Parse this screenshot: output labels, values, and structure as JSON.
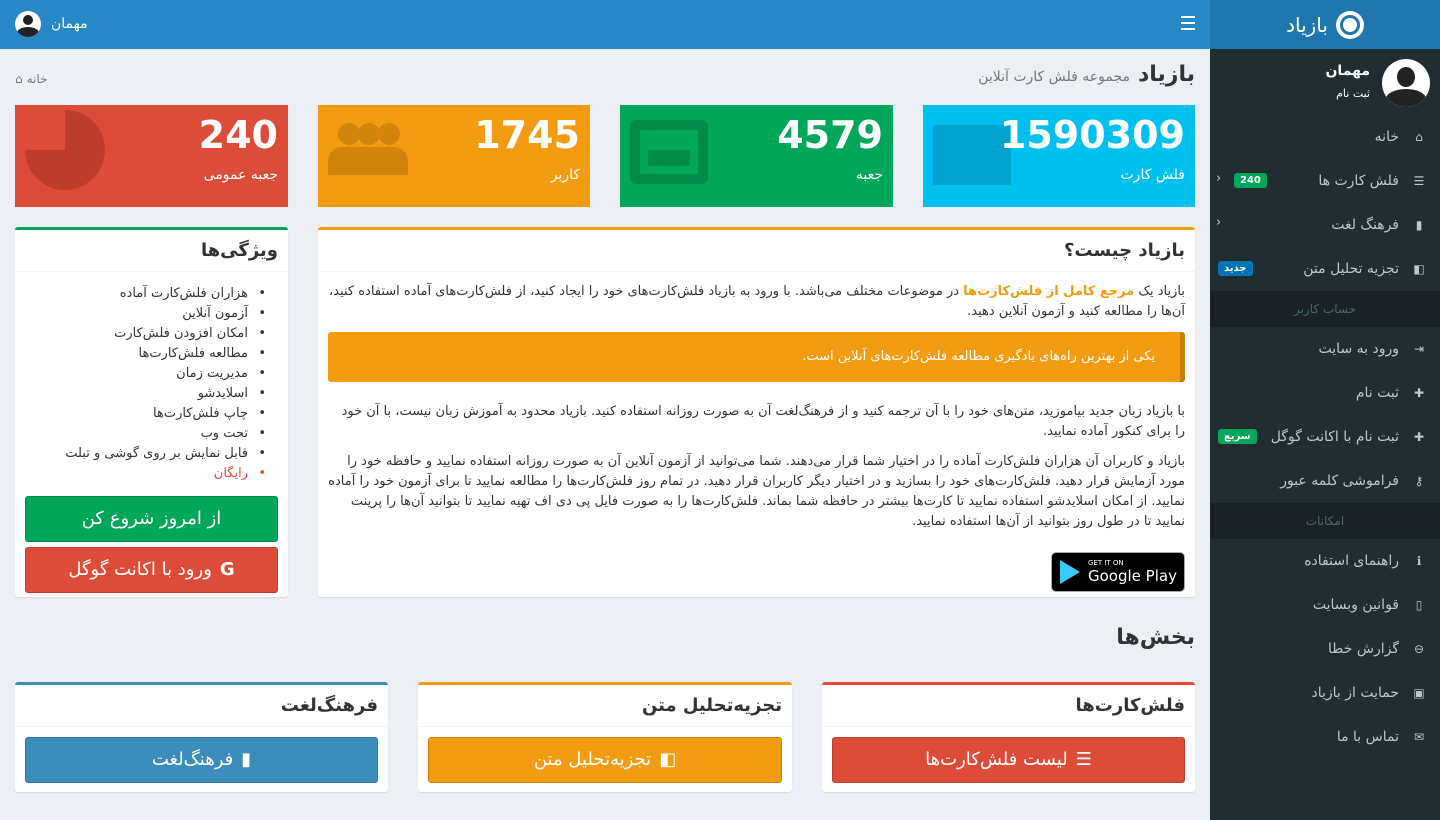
{
  "app": {
    "brand": "بازیاد",
    "user_name": "مهمان"
  },
  "sidebar": {
    "user_name": "مهمان",
    "user_sub": "ثبت نام",
    "items": [
      {
        "label": "خانه",
        "icon": "home-icon"
      },
      {
        "label": "فلش کارت ها",
        "icon": "database-icon",
        "badge": "240",
        "badge_color": "#00a65a"
      },
      {
        "label": "فرهنگ لغت",
        "icon": "book-icon"
      },
      {
        "label": "تجزیه تحلیل متن",
        "icon": "translate-icon",
        "badge": "جدید",
        "badge_color": "#0073b7"
      }
    ],
    "header_account": "حساب کاربر",
    "account_items": [
      {
        "label": "ورود به سایت",
        "icon": "sign-in-icon"
      },
      {
        "label": "ثبت نام",
        "icon": "user-plus-icon"
      },
      {
        "label": "ثبت نام با اکانت گوگل",
        "icon": "user-plus-icon",
        "badge": "سریع",
        "badge_color": "#00a65a"
      },
      {
        "label": "فراموشی کلمه عبور",
        "icon": "key-icon"
      }
    ],
    "header_features": "امکانات",
    "feature_items": [
      {
        "label": "راهنمای استفاده",
        "icon": "info-icon"
      },
      {
        "label": "قوانین وبسایت",
        "icon": "file-icon"
      },
      {
        "label": "گزارش خطا",
        "icon": "minus-circle-icon"
      },
      {
        "label": "حمایت از بازیاد",
        "icon": "money-icon"
      },
      {
        "label": "تماس با ما",
        "icon": "envelope-icon"
      }
    ]
  },
  "header": {
    "title": "بازیاد",
    "subtitle": "مجموعه فلش کارت آنلاین",
    "breadcrumb": "خانه"
  },
  "stats": [
    {
      "value": "1590309",
      "label": "فلش کارت",
      "color": "#00c0ef",
      "icon": "folder-icon"
    },
    {
      "value": "4579",
      "label": "جعبه",
      "color": "#00a65a",
      "icon": "inbox-icon"
    },
    {
      "value": "1745",
      "label": "کاربر",
      "color": "#f39c12",
      "icon": "users-icon"
    },
    {
      "value": "240",
      "label": "جعبه عمومی",
      "color": "#dd4b39",
      "icon": "pie-chart-icon"
    }
  ],
  "about": {
    "title": "بازیاد چیست؟",
    "p1_before": "بازیاد یک ",
    "p1_highlight": "مرجع کامل از فلش‌کارت‌ها",
    "p1_after": " در موضوعات مختلف می‌باشد. با ورود به بازیاد فلش‌کارت‌های خود را ایجاد کنید، از فلش‌کارت‌های آماده استفاده کنید، آن‌ها را مطالعه کنید و آزمون آنلاین دهید.",
    "callout": "یکی از بهترین راه‌های یادگیری مطالعه فلش‌کارت‌های آنلاین است.",
    "p2": "با بازیاد زبان جدید بیاموزید، متن‌های خود را با آن ترجمه کنید و از فرهنگ‌لغت آن به صورت روزانه استفاده کنید. بازیاد محدود به آموزش زبان نیست، با آن خود را برای کنکور آماده نمایید.",
    "p3": "بازیاد و کاربران آن هزاران فلش‌کارت آماده را در اختیار شما قرار می‌دهند. شما می‌توانید از آزمون آنلاین آن به صورت روزانه استفاده نمایید و حافظه خود را مورد آزمایش قرار دهید. فلش‌کارت‌های خود را بسازید و در اختیار دیگر کاربران قرار دهید. در تمام روز فلش‌کارت‌ها را مطالعه نمایید تا برای آزمون خود را آماده نمایید. از امکان اسلایدشو استفاده نمایید تا کارت‌ها بیشتر در حافظه شما بماند. فلش‌کارت‌ها را به صورت فایل پی دی اف تهیه نمایید تا بتوانید آن‌ها را پرینت نمایید تا در طول روز بتوانید از آن‌ها استفاده نمایید.",
    "gplay_small": "GET IT ON",
    "gplay_big": "Google Play"
  },
  "features": {
    "title": "ویژگی‌ها",
    "items": [
      "هزاران فلش‌کارت آماده",
      "آزمون آنلاین",
      "امکان افزودن فلش‌کارت",
      "مطالعه فلش‌کارت‌ها",
      "مدیریت زمان",
      "اسلایدشو",
      "چاپ فلش‌کارت‌ها",
      "تحت وب",
      "قابل نمایش بر روی گوشی و تبلت"
    ],
    "free": "رایگان",
    "start_button": "از امروز شروع کن",
    "google_button": "ورود با اکانت گوگل"
  },
  "sections": {
    "title": "بخش‌ها",
    "items": [
      {
        "title": "فلش‌کارت‌ها",
        "button": "لیست فلش‌کارت‌ها",
        "color": "#dd4b39",
        "icon": "database-icon"
      },
      {
        "title": "تجزیه‌تحلیل متن",
        "button": "تجزیه‌تحلیل متن",
        "color": "#f39c12",
        "icon": "translate-icon"
      },
      {
        "title": "فرهنگ‌لغت",
        "button": "فرهنگ‌لغت",
        "color": "#3c8dbc",
        "icon": "book-icon"
      }
    ]
  }
}
